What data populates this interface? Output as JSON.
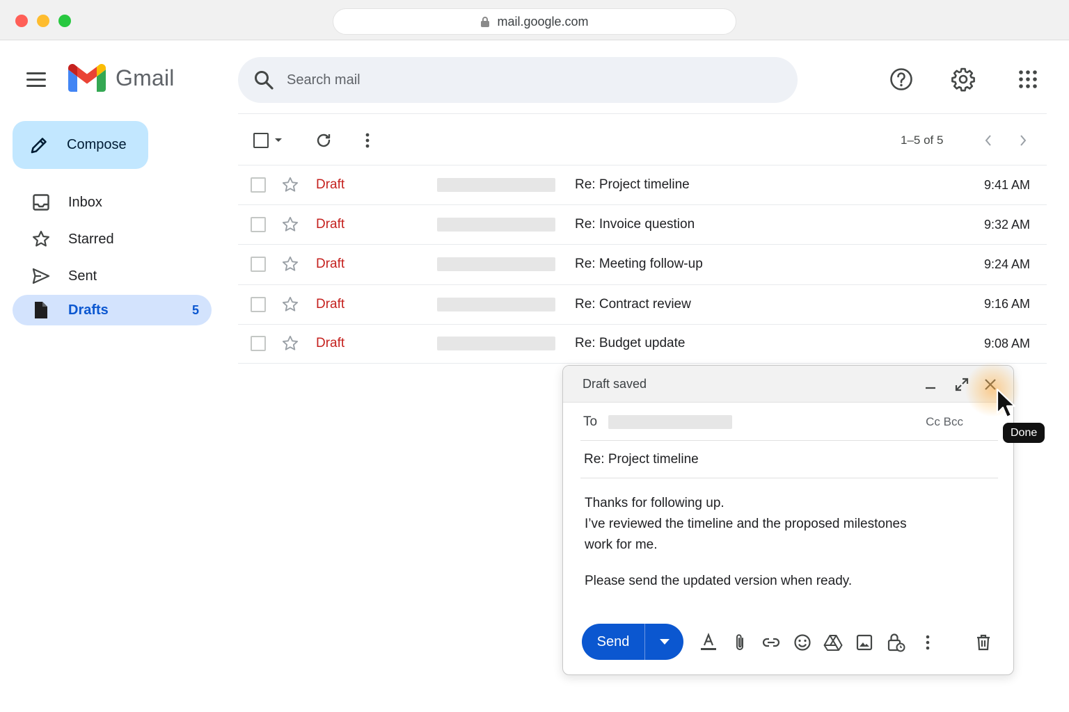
{
  "browser": {
    "url": "mail.google.com"
  },
  "app": {
    "name": "Gmail"
  },
  "search": {
    "placeholder": "Search mail"
  },
  "sidebar": {
    "compose_label": "Compose",
    "items": [
      {
        "label": "Inbox",
        "icon": "inbox-icon"
      },
      {
        "label": "Starred",
        "icon": "star-icon"
      },
      {
        "label": "Sent",
        "icon": "send-icon"
      },
      {
        "label": "Drafts",
        "icon": "draft-icon",
        "count": "5",
        "active": true
      }
    ]
  },
  "toolbar": {
    "pagination": "1–5 of 5"
  },
  "emails": [
    {
      "label": "Draft",
      "subject": "Re: Project timeline",
      "time": "9:41 AM"
    },
    {
      "label": "Draft",
      "subject": "Re: Invoice question",
      "time": "9:32 AM"
    },
    {
      "label": "Draft",
      "subject": "Re: Meeting follow-up",
      "time": "9:24 AM"
    },
    {
      "label": "Draft",
      "subject": "Re: Contract review",
      "time": "9:16 AM"
    },
    {
      "label": "Draft",
      "subject": "Re: Budget update",
      "time": "9:08 AM"
    }
  ],
  "composer": {
    "status": "Draft saved",
    "to_label": "To",
    "cc_bcc": "Cc Bcc",
    "subject": "Re: Project timeline",
    "body": {
      "line1": "Thanks for following up.",
      "line2": "I’ve reviewed the timeline and the proposed milestones",
      "line3": "work for me.",
      "line4": "Please send the updated version when ready."
    },
    "send_label": "Send"
  },
  "tooltip": {
    "text": "Done"
  },
  "colors": {
    "accent": "#0b57d0",
    "compose_bg": "#c2e7ff",
    "drafts_active_bg": "#d3e3fd",
    "draft_label": "#c5221f",
    "search_bg": "#eef1f6"
  }
}
